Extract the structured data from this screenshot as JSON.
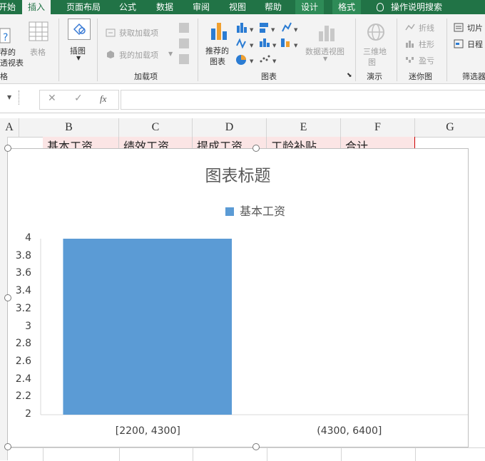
{
  "ribbon": {
    "tabs": [
      "开始",
      "插入",
      "页面布局",
      "公式",
      "数据",
      "审阅",
      "视图",
      "帮助",
      "设计",
      "格式"
    ],
    "tell_me": "操作说明搜索",
    "left_group": {
      "line1": "荐的",
      "line2": "透视表",
      "label": "格"
    },
    "table_label": "表格",
    "illustrations_label": "插图",
    "addins": {
      "get": "获取加载项",
      "mine": "我的加载项",
      "label": "加载项"
    },
    "recommended_charts": {
      "line1": "推荐的",
      "line2": "图表"
    },
    "pivot_chart": "数据透视图",
    "charts_label": "图表",
    "map3d": {
      "line1": "三维地",
      "line2": "图"
    },
    "tours_label": "演示",
    "sparklines": {
      "line": "折线",
      "column": "柱形",
      "winloss": "盈亏",
      "label": "迷你图"
    },
    "filters": {
      "slicer": "切片",
      "timeline": "日程",
      "label": "筛选器"
    }
  },
  "formula_bar": {
    "cancel": "✕",
    "enter": "✓",
    "fx": "fx",
    "value": ""
  },
  "sheet": {
    "columns": [
      "A",
      "B",
      "C",
      "D",
      "E",
      "F",
      "G"
    ],
    "header_cells": [
      "基本工资",
      "绩效工资",
      "提成工资",
      "工龄补贴",
      "合计"
    ]
  },
  "chart_data": {
    "type": "bar",
    "title": "图表标题",
    "categories": [
      "[2200, 4300]",
      "(4300, 6400]"
    ],
    "series": [
      {
        "name": "基本工资",
        "values": [
          4,
          2
        ],
        "color": "#5b9bd5"
      }
    ],
    "ylim": [
      2,
      4
    ],
    "yticks": [
      "4",
      "3.8",
      "3.6",
      "3.4",
      "3.2",
      "3",
      "2.8",
      "2.6",
      "2.4",
      "2.2",
      "2"
    ],
    "legend_position": "top",
    "grid": false
  }
}
